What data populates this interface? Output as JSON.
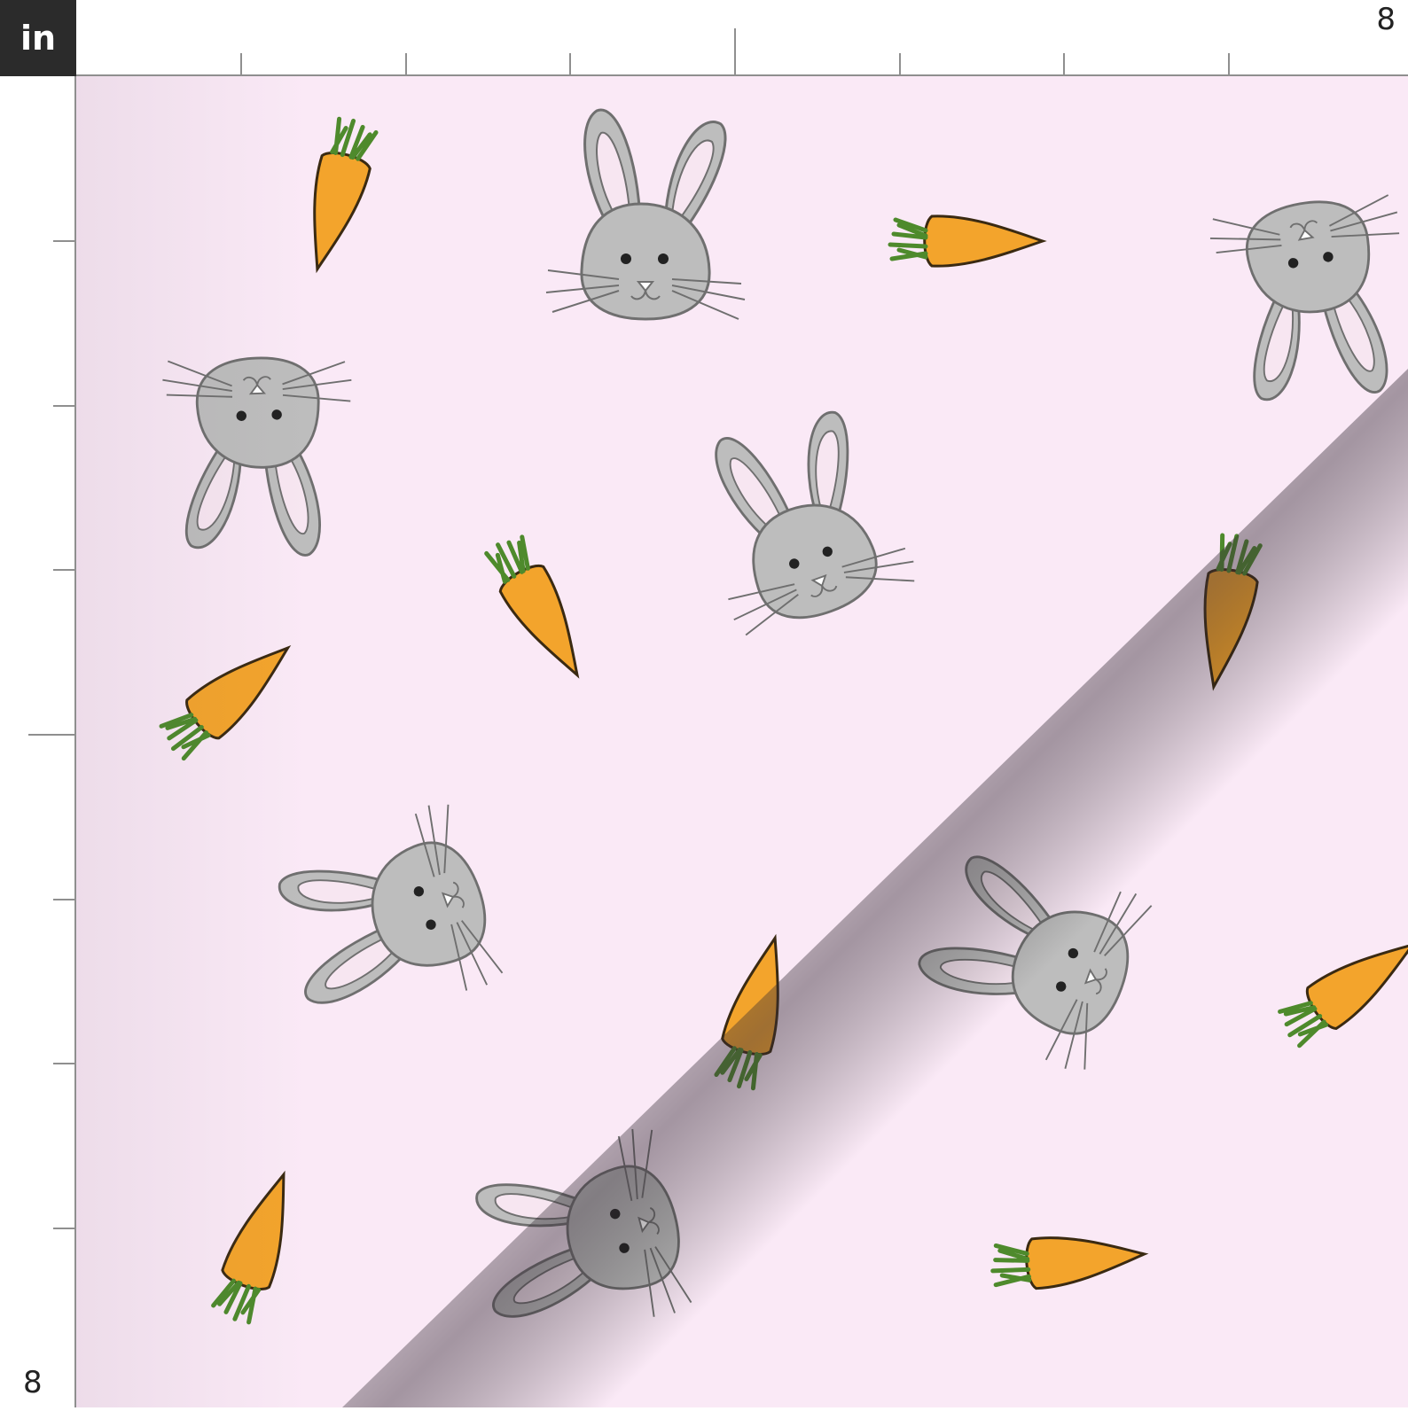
{
  "ruler": {
    "unit_label": "in",
    "top_end_label": "8",
    "left_end_label": "8"
  },
  "colors": {
    "fabric_background": "#fae9f6",
    "bunny_fill": "#bdbdbd",
    "bunny_stroke": "#6f6f6f",
    "carrot_fill": "#f3a42c",
    "carrot_stroke": "#3a2a12",
    "carrot_leaf": "#4e8a2c",
    "unit_box": "#2b2b2b"
  },
  "pattern": {
    "icons": [
      "bunny-head-icon",
      "carrot-icon"
    ]
  }
}
